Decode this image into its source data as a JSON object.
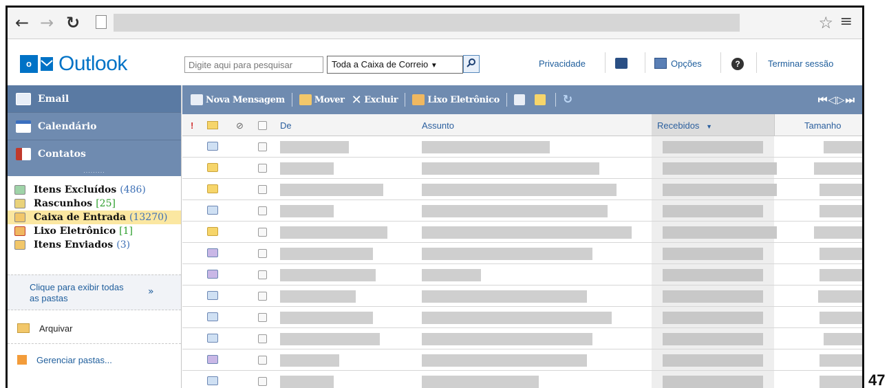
{
  "header": {
    "logo_mark": "o",
    "app_name": "Outlook",
    "search_placeholder": "Digite aqui para pesquisar",
    "scope": "Toda a Caixa de Correio",
    "links": {
      "privacy": "Privacidade",
      "options": "Opções",
      "signout": "Terminar sessão"
    }
  },
  "nav": {
    "email": "Email",
    "calendar": "Calendário",
    "contacts": "Contatos"
  },
  "folders": [
    {
      "name": "Itens Excluídos",
      "count": "(486)"
    },
    {
      "name": "Rascunhos",
      "count": "[25]"
    },
    {
      "name": "Caixa de Entrada",
      "count": "(13270)"
    },
    {
      "name": "Lixo Eletrônico",
      "count": "[1]"
    },
    {
      "name": "Itens Enviados",
      "count": "(3)"
    }
  ],
  "left": {
    "show_all_line1": "Clique para exibir todas",
    "show_all_line2": "as pastas",
    "archive": "Arquivar",
    "manage": "Gerenciar pastas..."
  },
  "toolbar": {
    "new": "Nova Mensagem",
    "move": "Mover",
    "delete": "Excluir",
    "junk": "Lixo Eletrônico"
  },
  "columns": {
    "from": "De",
    "subject": "Assunto",
    "received": "Recebidos",
    "size": "Tamanho"
  },
  "page_number": "47",
  "colors": {
    "accent": "#0072c6",
    "nav": "#6f8bb0",
    "selected_folder": "#fbe7a1"
  },
  "rows": [
    {
      "icon": "read-mail-icon"
    },
    {
      "icon": "unread-mail-icon"
    },
    {
      "icon": "unread-mail-icon"
    },
    {
      "icon": "read-mail-icon"
    },
    {
      "icon": "unread-mail-icon"
    },
    {
      "icon": "forwarded-mail-icon"
    },
    {
      "icon": "forwarded-mail-icon"
    },
    {
      "icon": "read-mail-icon"
    },
    {
      "icon": "read-mail-icon"
    },
    {
      "icon": "read-mail-icon"
    },
    {
      "icon": "forwarded-mail-icon"
    },
    {
      "icon": "read-mail-icon"
    }
  ]
}
